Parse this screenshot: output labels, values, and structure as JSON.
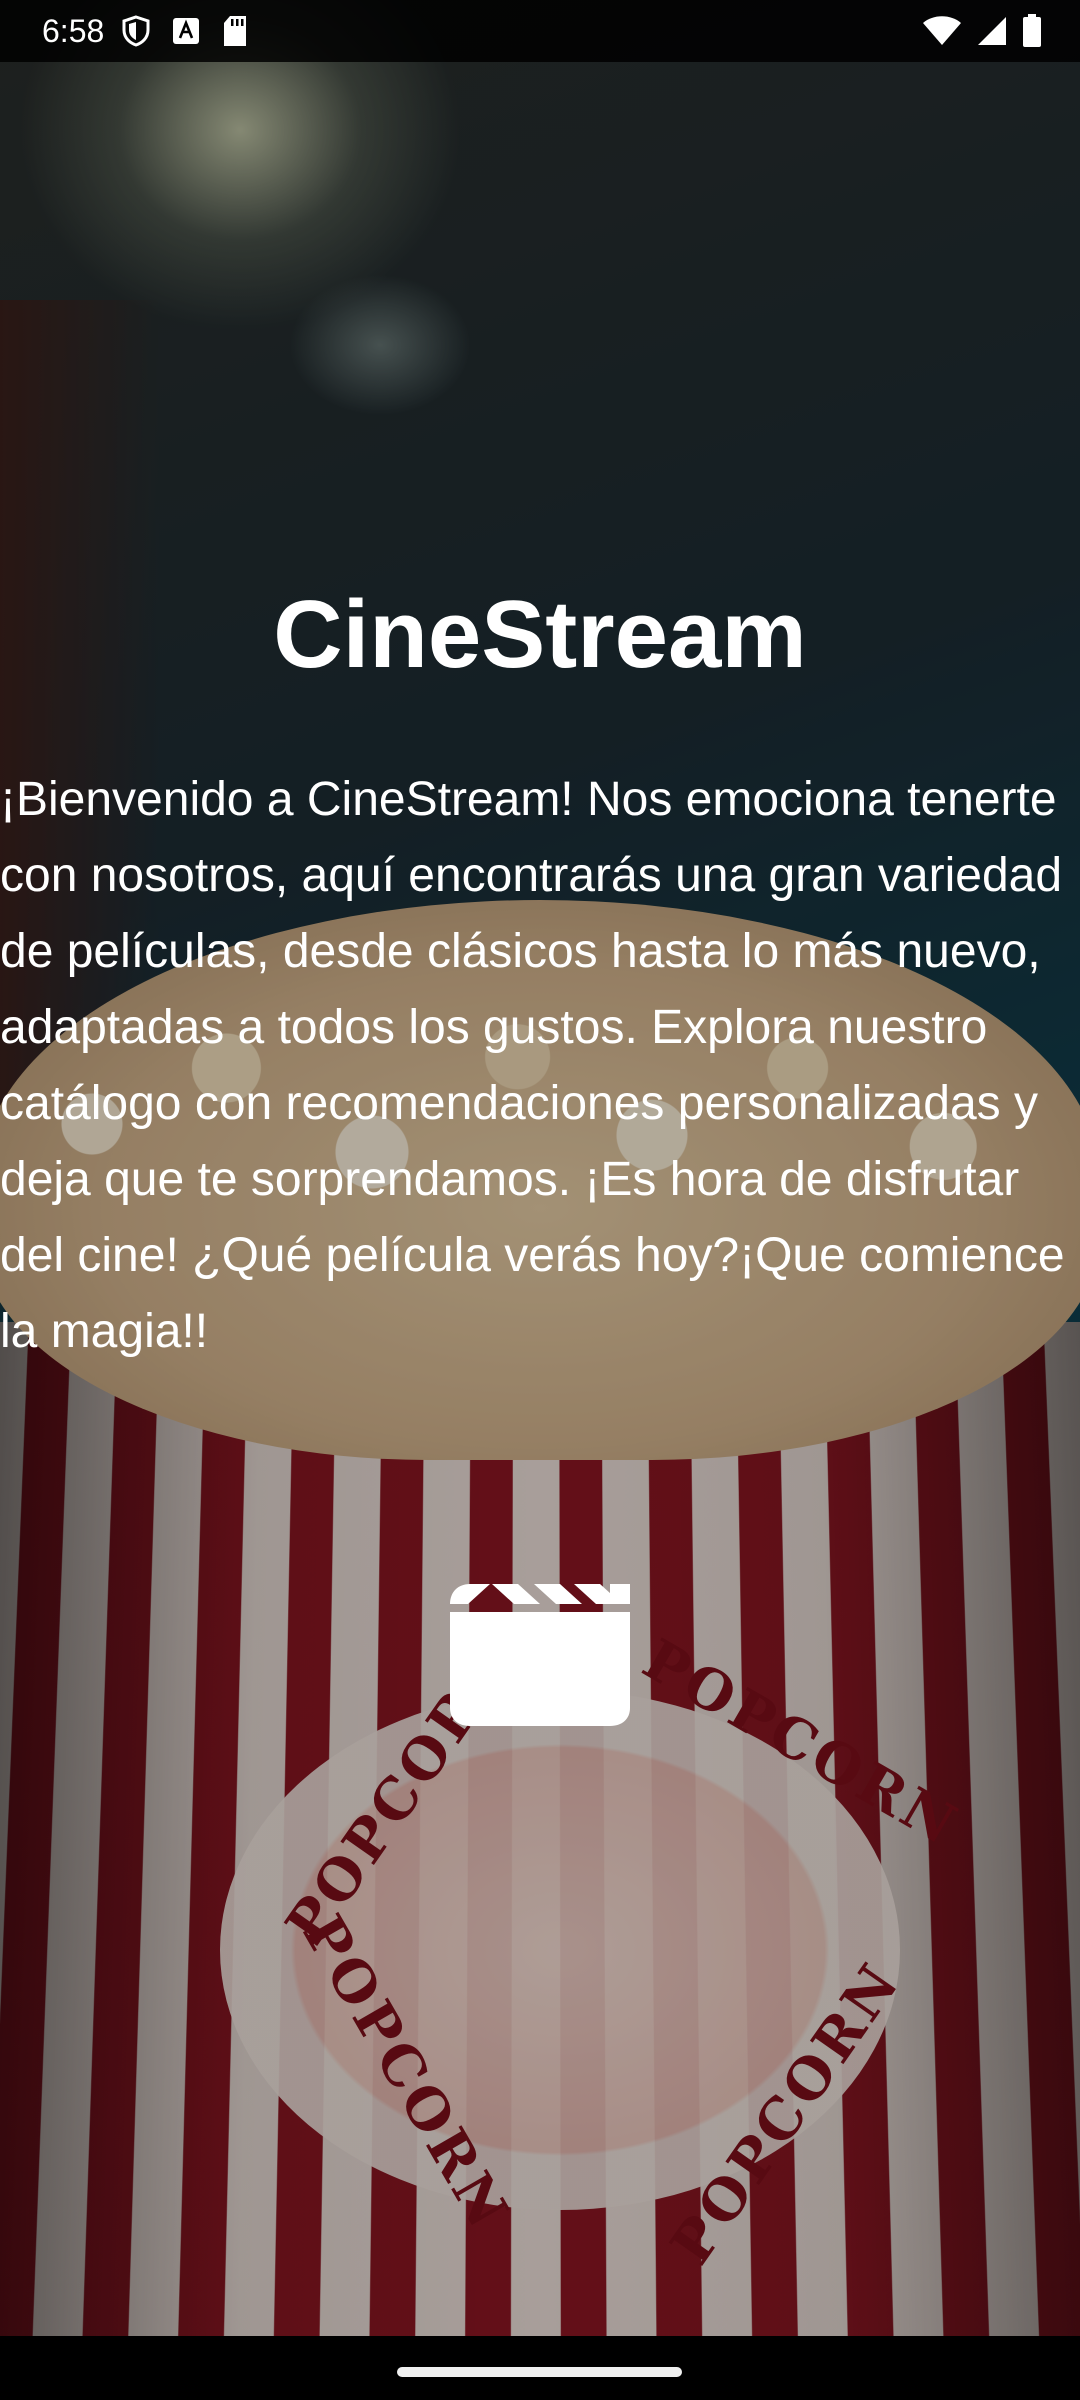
{
  "status_bar": {
    "time": "6:58",
    "left_icons": [
      "shield-icon",
      "font-icon",
      "sd-card-icon"
    ],
    "right_icons": [
      "wifi-icon",
      "cell-signal-icon",
      "battery-icon"
    ]
  },
  "app": {
    "title": "CineStream",
    "welcome": "¡Bienvenido a CineStream! Nos emociona tenerte con nosotros, aquí encontrarás una gran variedad de películas, desde clásicos hasta lo más nuevo, adaptadas a todos los gustos. Explora nuestro catálogo con recomendaciones personalizadas y deja que te sorprendamos. ¡Es hora de disfrutar del cine! ¿Qué película verás hoy?¡Que comience la magia!!",
    "action_icon": "movie-clapper-icon"
  },
  "background": {
    "badge_words": [
      "POPCORN",
      "POPCORN",
      "POPCORN",
      "POPCORN"
    ]
  },
  "colors": {
    "text": "#ffffff",
    "stripe_red": "#8a1622",
    "stripe_white": "#e9dcd6"
  }
}
